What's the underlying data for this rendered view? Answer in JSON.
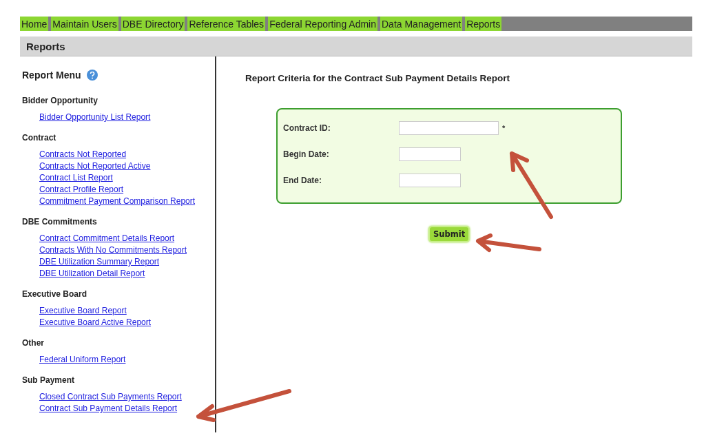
{
  "nav": [
    {
      "label": "Home"
    },
    {
      "label": "Maintain Users"
    },
    {
      "label": "DBE Directory"
    },
    {
      "label": "Reference Tables"
    },
    {
      "label": "Federal Reporting Admin"
    },
    {
      "label": "Data Management"
    },
    {
      "label": "Reports"
    }
  ],
  "page_title": "Reports",
  "report_menu": {
    "title": "Report Menu",
    "sections": [
      {
        "heading": "Bidder Opportunity",
        "links": [
          "Bidder Opportunity List Report"
        ]
      },
      {
        "heading": "Contract",
        "links": [
          "Contracts Not Reported",
          "Contracts Not Reported Active",
          "Contract List Report",
          "Contract Profile Report",
          "Commitment Payment Comparison Report"
        ]
      },
      {
        "heading": "DBE Commitments",
        "links": [
          "Contract Commitment Details Report",
          "Contracts With No Commitments Report",
          "DBE Utilization Summary Report",
          "DBE Utilization Detail Report"
        ]
      },
      {
        "heading": "Executive Board",
        "links": [
          "Executive Board Report",
          "Executive Board Active Report"
        ]
      },
      {
        "heading": "Other",
        "links": [
          "Federal Uniform Report"
        ]
      },
      {
        "heading": "Sub Payment",
        "links": [
          "Closed Contract Sub Payments Report",
          "Contract Sub Payment Details Report"
        ]
      }
    ]
  },
  "criteria": {
    "title": "Report Criteria for the Contract Sub Payment Details Report",
    "fields": [
      {
        "label": "Contract ID:",
        "kind": "id",
        "required_mark": "*"
      },
      {
        "label": "Begin Date:",
        "kind": "date"
      },
      {
        "label": "End Date:",
        "kind": "date"
      }
    ],
    "submit": "Submit"
  }
}
